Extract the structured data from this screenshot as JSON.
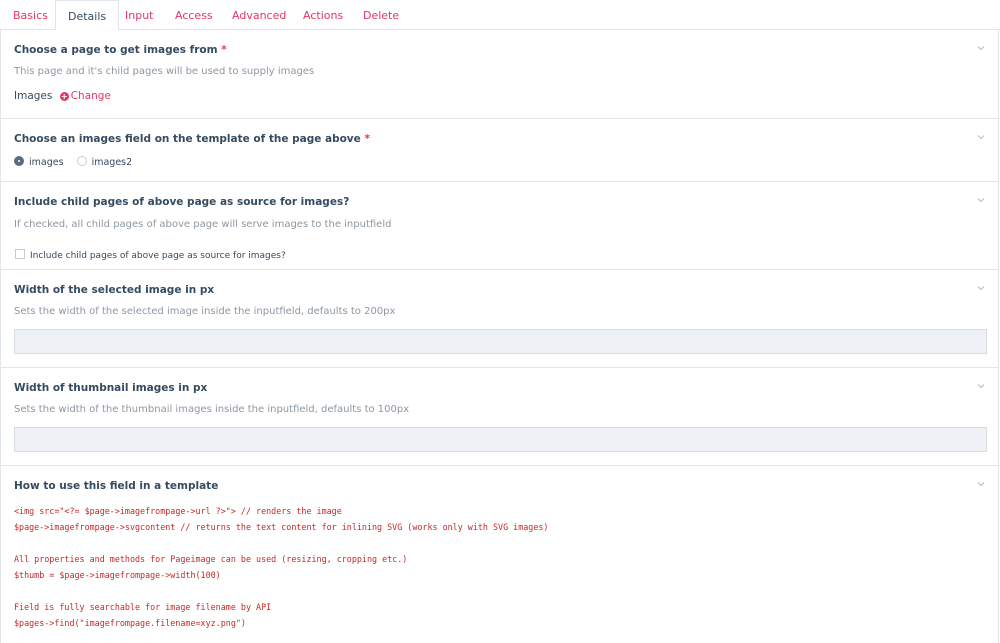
{
  "tabs": [
    {
      "label": "Basics",
      "active": false
    },
    {
      "label": "Details",
      "active": true
    },
    {
      "label": "Input",
      "active": false
    },
    {
      "label": "Access",
      "active": false
    },
    {
      "label": "Advanced",
      "active": false
    },
    {
      "label": "Actions",
      "active": false
    },
    {
      "label": "Delete",
      "active": false
    }
  ],
  "page_source": {
    "title": "Choose a page to get images from",
    "required_mark": "*",
    "description": "This page and it's child pages will be used to supply images",
    "current_value": "Images",
    "change_label": "Change"
  },
  "images_field": {
    "title": "Choose an images field on the template of the page above",
    "required_mark": "*",
    "options": [
      {
        "label": "images",
        "checked": true
      },
      {
        "label": "images2",
        "checked": false
      }
    ]
  },
  "include_children": {
    "title": "Include child pages of above page as source for images?",
    "description": "If checked, all child pages of above page will serve images to the inputfield",
    "checkbox_label": "Include child pages of above page as source for images?",
    "checked": false
  },
  "selected_width": {
    "title": "Width of the selected image in px",
    "description": "Sets the width of the selected image inside the inputfield, defaults to 200px",
    "value": ""
  },
  "thumb_width": {
    "title": "Width of thumbnail images in px",
    "description": "Sets the width of the thumbnail images inside the inputfield, defaults to 100px",
    "value": ""
  },
  "usage": {
    "title": "How to use this field in a template",
    "code_lines": [
      "<img src=\"<?= $page->imagefrompage->url ?>\"> // renders the image",
      "$page->imagefrompage->svgcontent // returns the text content for inlining SVG (works only with SVG images)",
      "",
      "All properties and methods for Pageimage can be used (resizing, cropping etc.)",
      "$thumb = $page->imagefrompage->width(100)",
      "",
      "Field is fully searchable for image filename by API",
      "$pages->find(\"imagefrompage.filename=xyz.png\")"
    ]
  },
  "colors": {
    "accent": "#e83561",
    "text": "#354b60",
    "muted": "#8d97a2",
    "input_bg": "#eef2f6",
    "code": "#c62828"
  },
  "icons": {
    "collapse": "chevron-down-icon",
    "change": "plus-circle-icon"
  }
}
